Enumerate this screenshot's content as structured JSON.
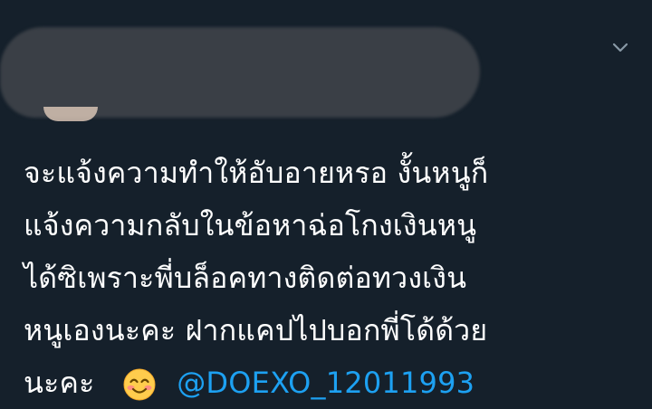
{
  "tweet": {
    "text_lines": [
      "จะแจ้งความทำให้อับอายหรอ งั้นหนูก็",
      "แจ้งความกลับในข้อหาฉ่อโกงเงินหนู",
      "ได้ซิเพราะพี่บล็อคทางติดต่อทวงเงิน",
      "หนูเองนะคะ ฝากแคปไปบอกพี่โด้ด้วย"
    ],
    "last_line_text": "นะคะ",
    "mention": "@DOEXO_12011993"
  },
  "icons": {
    "menu": "chevron-down-icon",
    "emoji": "smiling-face-with-smiling-eyes-icon"
  },
  "colors": {
    "background": "#15202b",
    "text": "#ffffff",
    "mention": "#1da1f2",
    "chevron": "#8899a6",
    "redaction": "#3a3f46"
  }
}
